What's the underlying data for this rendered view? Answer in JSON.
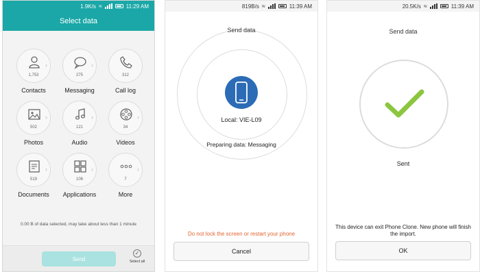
{
  "screen1": {
    "status": {
      "speed": "1.9K/s",
      "time": "11:29 AM"
    },
    "title": "Select data",
    "items": [
      {
        "label": "Contacts",
        "count": "1,753",
        "icon": "contact-icon"
      },
      {
        "label": "Messaging",
        "count": "275",
        "icon": "message-icon"
      },
      {
        "label": "Call log",
        "count": "312",
        "icon": "phone-icon"
      },
      {
        "label": "Photos",
        "count": "502",
        "icon": "photo-icon"
      },
      {
        "label": "Audio",
        "count": "121",
        "icon": "music-icon"
      },
      {
        "label": "Videos",
        "count": "34",
        "icon": "film-icon"
      },
      {
        "label": "Documents",
        "count": "519",
        "icon": "document-icon"
      },
      {
        "label": "Applications",
        "count": "106",
        "icon": "apps-icon"
      },
      {
        "label": "More",
        "count": "7",
        "icon": "more-icon"
      }
    ],
    "info": "0.00 B of data selected, may take about less than 1 minute",
    "send_label": "Send",
    "select_all_label": "Select all"
  },
  "screen2": {
    "status": {
      "speed": "819B/s",
      "time": "11:39 AM"
    },
    "title": "Send data",
    "local": "Local: VIE-L09",
    "preparing": "Preparing data: Messaging",
    "warning": "Do not lock the screen or restart your phone",
    "cancel_label": "Cancel"
  },
  "screen3": {
    "status": {
      "speed": "20.5K/s",
      "time": "11:39 AM"
    },
    "title": "Send data",
    "sent": "Sent",
    "exit_message": "This device can exit Phone Clone. New phone will finish the import.",
    "ok_label": "OK"
  },
  "colors": {
    "teal": "#1ba7a7",
    "send_disabled": "#a9e2e0",
    "phone_badge": "#2c6bb6",
    "check_green": "#8cc63f",
    "warning": "#e3632e"
  }
}
